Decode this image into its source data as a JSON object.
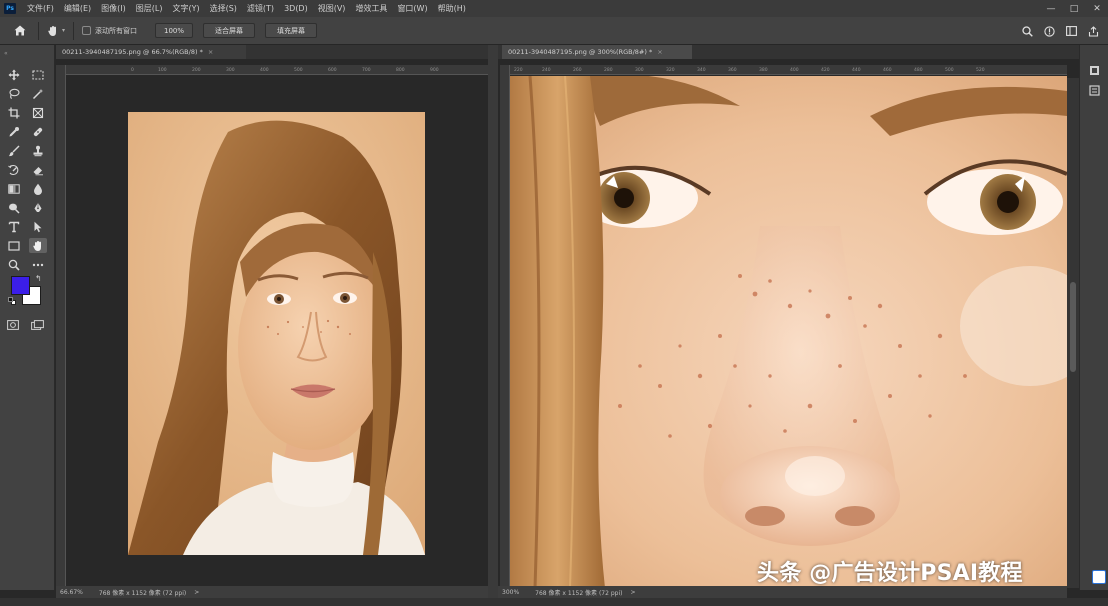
{
  "menubar": {
    "logo": "Ps",
    "items": [
      "文件(F)",
      "编辑(E)",
      "图像(I)",
      "图层(L)",
      "文字(Y)",
      "选择(S)",
      "滤镜(T)",
      "3D(D)",
      "视图(V)",
      "增效工具",
      "窗口(W)",
      "帮助(H)"
    ],
    "window_controls": [
      "—",
      "□",
      "✕"
    ]
  },
  "options": {
    "scroll_all_label": "滚动所有窗口",
    "zoom_value": "100%",
    "fit_screen_label": "适合屏幕",
    "fill_screen_label": "填充屏幕"
  },
  "tools": [
    "move-tool",
    "marquee-tool",
    "lasso-tool",
    "magic-wand-tool",
    "crop-tool",
    "frame-tool",
    "eyedropper-tool",
    "healing-brush-tool",
    "brush-tool",
    "clone-stamp-tool",
    "history-brush-tool",
    "eraser-tool",
    "gradient-tool",
    "blur-tool",
    "dodge-tool",
    "pen-tool",
    "type-tool",
    "path-selection-tool",
    "rectangle-tool",
    "hand-tool",
    "zoom-tool",
    "more-tools"
  ],
  "colors": {
    "foreground": "#3b1ee8",
    "background": "#ffffff",
    "chrome_dark": "#282828",
    "chrome_mid": "#424242",
    "portrait_backdrop": "#e6bc92",
    "skin": "#efc4a0",
    "hair": "#9b6533"
  },
  "left_doc": {
    "tab_title": "00211-3940487195.png @ 66.7%(RGB/8) *",
    "tab_close": "×",
    "ruler_ticks": [
      "0",
      "100",
      "200",
      "300",
      "400",
      "500",
      "600",
      "700",
      "800",
      "900"
    ],
    "status_zoom": "66.67%",
    "status_info": "768 像素 x 1152 像素 (72 ppi)",
    "status_arrow": ">"
  },
  "right_doc": {
    "tab_title": "00211-3940487195.png @ 300%(RGB/8#) *",
    "tab_close": "×",
    "ruler_ticks": [
      "220",
      "240",
      "260",
      "280",
      "300",
      "320",
      "340",
      "360",
      "380",
      "400",
      "420",
      "440",
      "460",
      "480",
      "500",
      "520"
    ],
    "status_zoom": "300%",
    "status_info": "768 像素 x 1152 像素 (72 ppi)",
    "status_arrow": ">"
  },
  "watermark": {
    "text": "头条 @广告设计PSAI教程"
  }
}
